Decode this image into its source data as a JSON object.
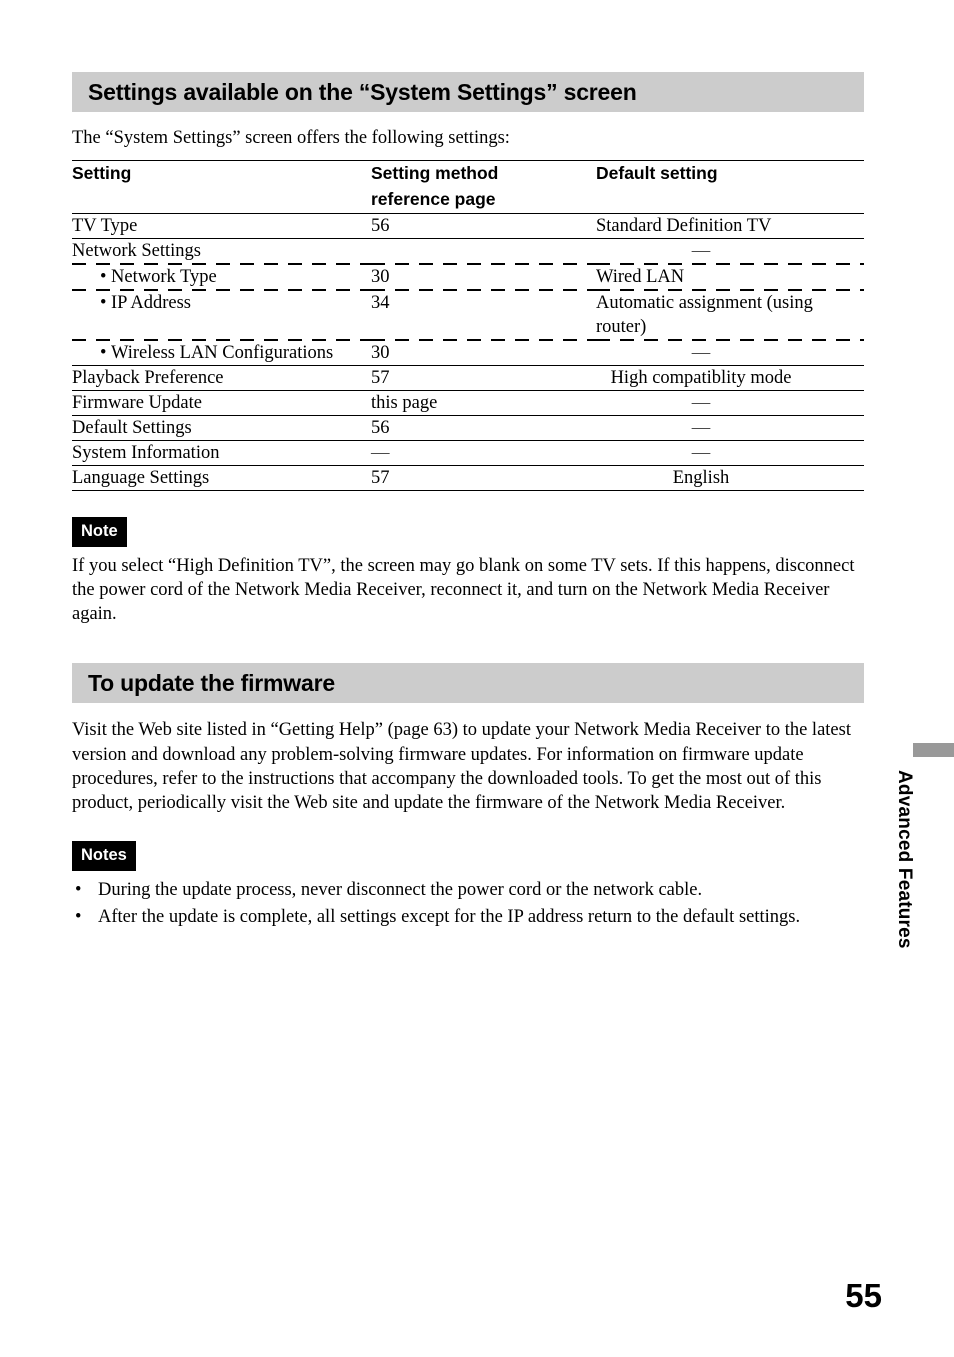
{
  "page": {
    "number": "55",
    "thumb_tab_label": "Advanced Features",
    "band_color": "#cccccc",
    "tab_marker_color": "#999999"
  },
  "section1": {
    "heading": "Settings available on the “System Settings” screen",
    "intro": "The “System Settings” screen offers the following settings:",
    "table": {
      "headers": {
        "col1": "Setting",
        "col2_line1": "Setting method",
        "col2_line2": "reference page",
        "col3": "Default setting"
      },
      "rows": [
        {
          "setting": "TV Type",
          "indent": false,
          "page": "56",
          "default": "Standard Definition TV",
          "default_style": "left",
          "separator": "solid"
        },
        {
          "setting": "Network Settings",
          "indent": false,
          "page": "",
          "default": "—",
          "default_style": "dash",
          "separator": "dashed"
        },
        {
          "setting": "Network Type",
          "indent": true,
          "page": "30",
          "default": "Wired LAN",
          "default_style": "left",
          "separator": "dashed"
        },
        {
          "setting": "IP Address",
          "indent": true,
          "page": "34",
          "default": "Automatic assignment (using router)",
          "default_style": "left",
          "separator": "dashed"
        },
        {
          "setting": "Wireless LAN Configurations",
          "indent": true,
          "page": "30",
          "default": "—",
          "default_style": "dash",
          "separator": "solid"
        },
        {
          "setting": "Playback Preference",
          "indent": false,
          "page": "57",
          "default": "High compatiblity mode",
          "default_style": "center",
          "separator": "solid"
        },
        {
          "setting": "Firmware Update",
          "indent": false,
          "page": "this page",
          "default": "—",
          "default_style": "dash",
          "separator": "solid"
        },
        {
          "setting": "Default Settings",
          "indent": false,
          "page": "56",
          "default": "—",
          "default_style": "dash",
          "separator": "solid"
        },
        {
          "setting": "System Information",
          "indent": false,
          "page": "—",
          "default": "—",
          "default_style": "dash",
          "separator": "solid"
        },
        {
          "setting": "Language Settings",
          "indent": false,
          "page": "57",
          "default": "English",
          "default_style": "center",
          "separator": "solid"
        }
      ]
    },
    "note": {
      "tag": "Note",
      "text": "If you select “High Definition TV”, the screen may go blank on some TV sets. If this happens, disconnect the power cord of the Network Media Receiver, reconnect it, and turn on the Network Media Receiver again."
    }
  },
  "section2": {
    "heading": "To update the firmware",
    "paragraph": "Visit the Web site listed in “Getting Help” (page 63) to update your Network Media Receiver to the latest version and download any problem-solving firmware updates. For information on firmware update procedures, refer to the instructions that accompany the downloaded tools. To get the most out of this product, periodically visit the Web site and update the firmware of the Network Media Receiver.",
    "notes": {
      "tag": "Notes",
      "bullet": "•",
      "items": [
        "During the update process, never disconnect the power cord or the network cable.",
        "After the update is complete, all settings except for the IP address return to the default settings."
      ]
    }
  }
}
